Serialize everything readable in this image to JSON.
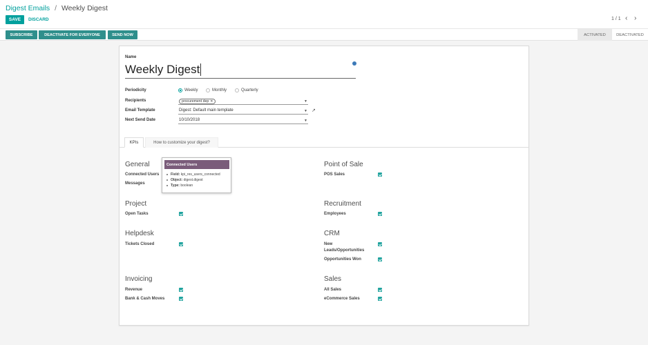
{
  "breadcrumb": {
    "parent": "Digest Emails",
    "separator": "/",
    "current": "Weekly Digest"
  },
  "actions": {
    "save": "SAVE",
    "discard": "DISCARD"
  },
  "pager": {
    "value": "1 / 1",
    "prev": "‹",
    "next": "›"
  },
  "header_buttons": {
    "subscribe": "SUBSCRIBE",
    "deactivate": "DEACTIVATE FOR EVERYONE",
    "send_now": "SEND NOW"
  },
  "stages": {
    "activated": "ACTIVATED",
    "deactivated": "DEACTIVATED"
  },
  "form": {
    "name_label": "Name",
    "name_value": "Weekly Digest",
    "periodicity_label": "Periodicity",
    "periodicity_options": [
      "Weekly",
      "Monthly",
      "Quarterly"
    ],
    "periodicity_selected": "Weekly",
    "recipients_label": "Recipients",
    "recipients_tag": "procurement dep",
    "template_label": "Email Template",
    "template_value": "Digest: Default main template",
    "next_send_label": "Next Send Date",
    "next_send_value": "10/10/2018"
  },
  "tabs": [
    "KPIs",
    "How to customize your digest?"
  ],
  "groups": {
    "general": {
      "title": "General",
      "items": [
        "Connected Users",
        "Messages"
      ]
    },
    "project": {
      "title": "Project",
      "items": [
        "Open Tasks"
      ]
    },
    "helpdesk": {
      "title": "Helpdesk",
      "items": [
        "Tickets Closed"
      ]
    },
    "invoicing": {
      "title": "Invoicing",
      "items": [
        "Revenue",
        "Bank & Cash Moves"
      ]
    },
    "pos": {
      "title": "Point of Sale",
      "items": [
        "POS Sales"
      ]
    },
    "recruitment": {
      "title": "Recruitment",
      "items": [
        "Employees"
      ]
    },
    "crm": {
      "title": "CRM",
      "items": [
        "New Leads/Opportunities",
        "Opportunities Won"
      ]
    },
    "sales": {
      "title": "Sales",
      "items": [
        "All Sales",
        "eCommerce Sales"
      ]
    }
  },
  "tooltip": {
    "title": "Connected Users",
    "field_label": "Field:",
    "field_value": "kpi_res_users_connected",
    "object_label": "Object:",
    "object_value": "digest.digest",
    "type_label": "Type:",
    "type_value": "boolean"
  },
  "colors": {
    "accent": "#00A09D",
    "tooltip_header": "#7a5c7a"
  }
}
